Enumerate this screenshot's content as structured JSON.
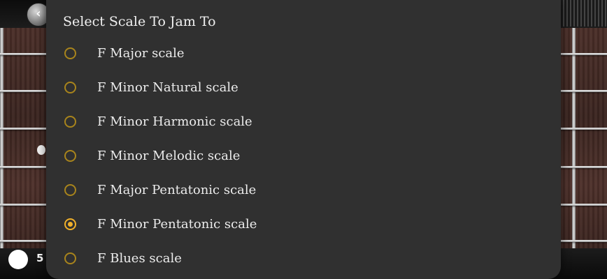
{
  "background": {
    "back_icon": "chevron-left-icon",
    "fret_number": "5"
  },
  "dialog": {
    "title": "Select Scale To Jam To",
    "accent_color": "#f0b02a",
    "options": [
      {
        "label": "F Major scale",
        "selected": false
      },
      {
        "label": "F Minor Natural scale",
        "selected": false
      },
      {
        "label": "F Minor Harmonic scale",
        "selected": false
      },
      {
        "label": "F Minor Melodic scale",
        "selected": false
      },
      {
        "label": "F Major Pentatonic scale",
        "selected": false
      },
      {
        "label": "F Minor Pentatonic scale",
        "selected": true
      },
      {
        "label": "F Blues scale",
        "selected": false
      }
    ]
  }
}
